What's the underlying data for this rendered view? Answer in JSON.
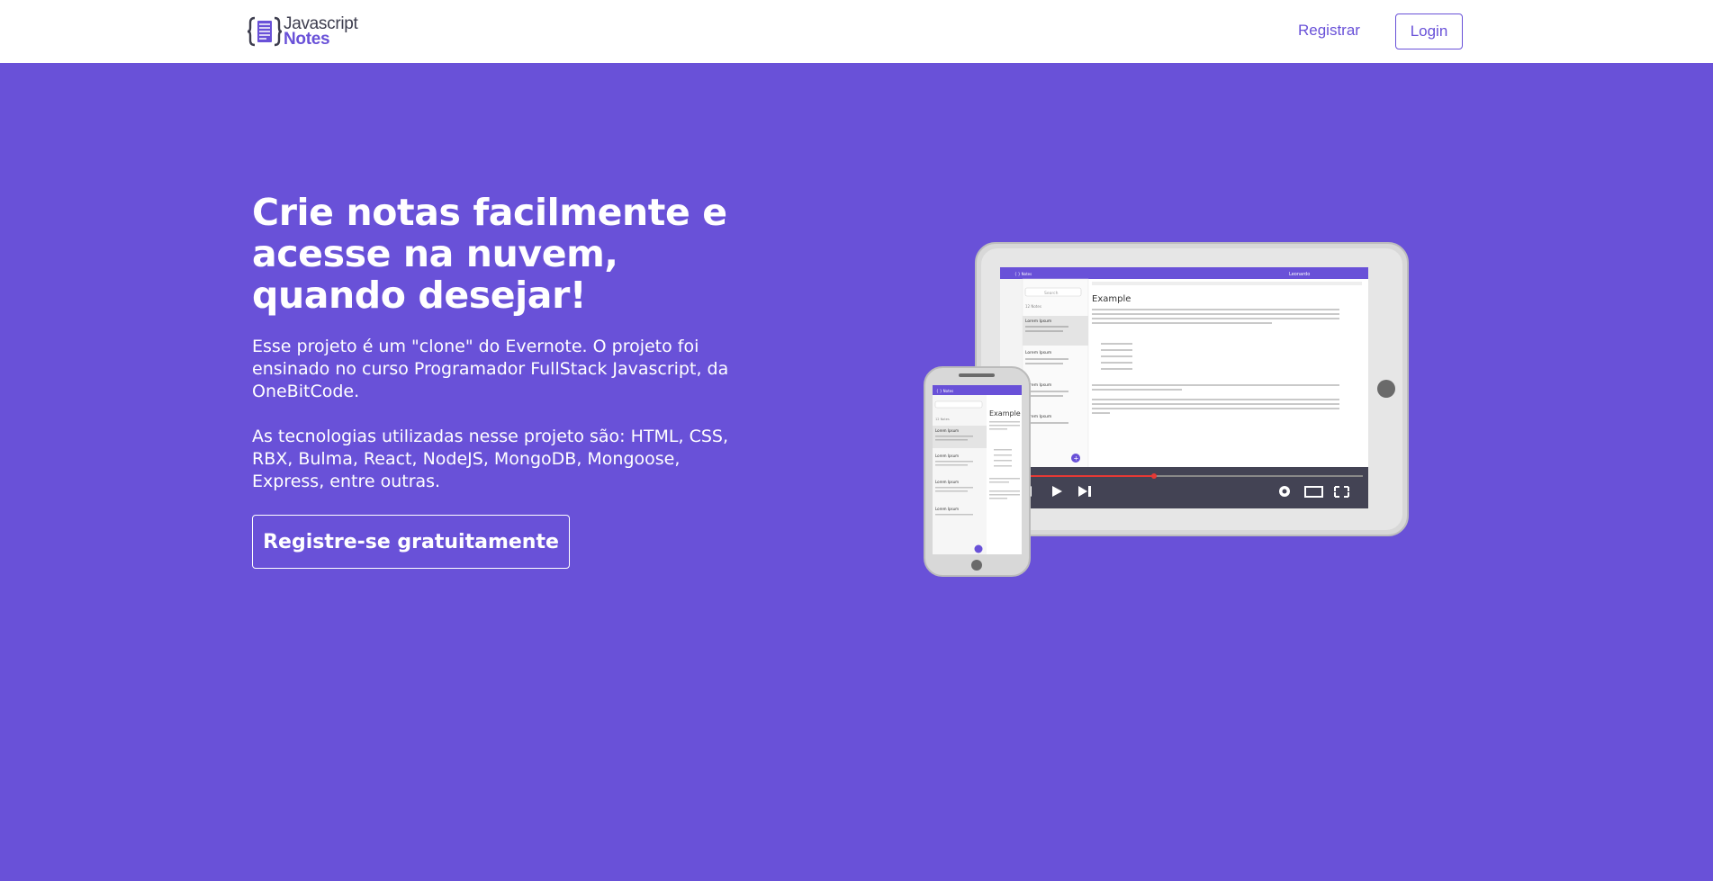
{
  "brand": {
    "line1": "Javascript",
    "line2": "Notes"
  },
  "nav": {
    "register": "Registrar",
    "login": "Login"
  },
  "hero": {
    "title": "Crie notas facilmente e acesse na nuvem, quando desejar!",
    "paragraph1": "Esse projeto é um \"clone\" do Evernote. O projeto foi ensinado no curso Programador FullStack Javascript, da OneBitCode.",
    "paragraph2": "As tecnologias utilizadas nesse projeto são: HTML, CSS, RBX, Bulma, React, NodeJS, MongoDB, Mongoose, Express, entre outras.",
    "cta": "Registre-se gratuitamente"
  },
  "mockup": {
    "tablet_user": "Leonardo",
    "tablet_search": "Search",
    "tablet_notes_count": "12 Notes",
    "tablet_note_title": "Lorem Ipsum",
    "tablet_editor_title": "Example",
    "phone_editor_title": "Example",
    "phone_notes_count": "12 Notes",
    "phone_note_title": "Lorem Ipsum"
  },
  "colors": {
    "brand": "#6951d8",
    "white": "#ffffff",
    "dark": "#3d3d4e"
  }
}
